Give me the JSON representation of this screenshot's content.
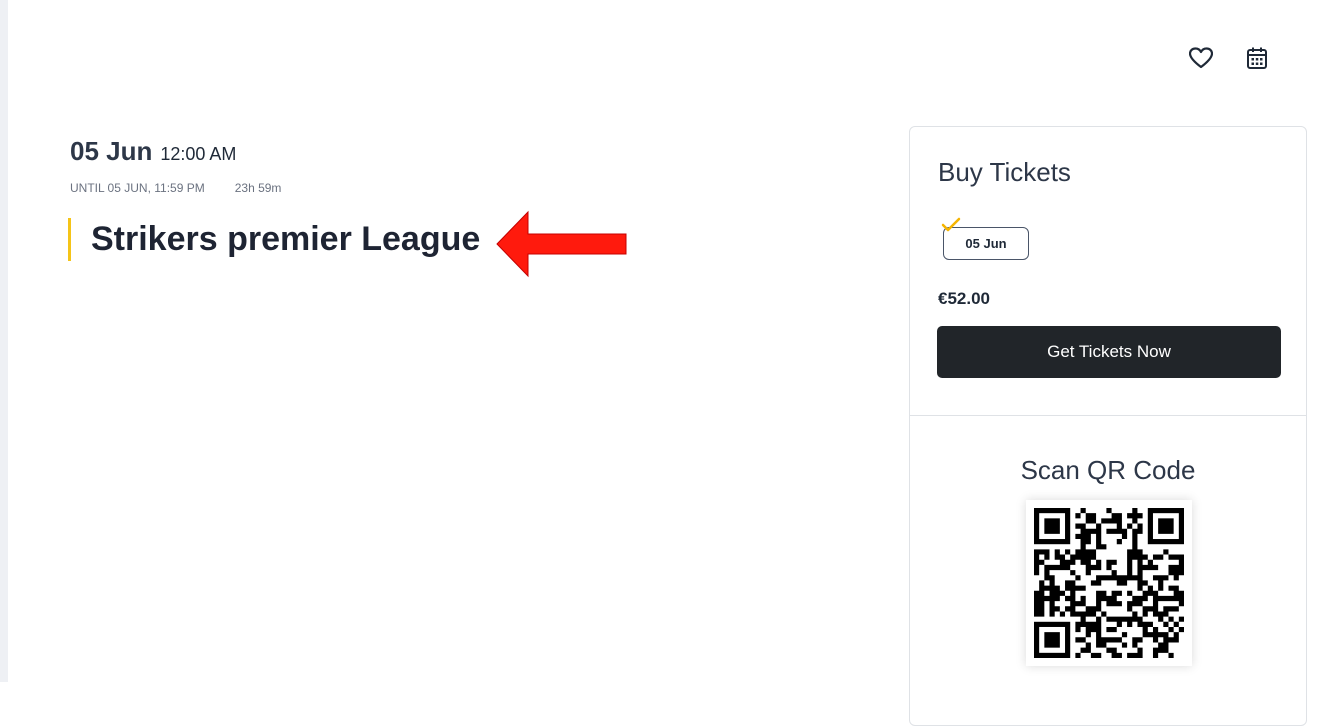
{
  "header": {
    "icons": [
      "heart-icon",
      "calendar-icon"
    ]
  },
  "event": {
    "date": "05 Jun",
    "time": "12:00 AM",
    "until": "UNTIL 05 JUN, 11:59 PM",
    "duration": "23h 59m",
    "title": "Strikers premier League"
  },
  "tickets": {
    "heading": "Buy Tickets",
    "date_option": "05 Jun",
    "price": "€52.00",
    "button_label": "Get Tickets Now"
  },
  "qr": {
    "heading": "Scan QR Code"
  },
  "colors": {
    "accent": "#f5c418",
    "button": "#212529",
    "arrow": "#ff1a0d"
  }
}
